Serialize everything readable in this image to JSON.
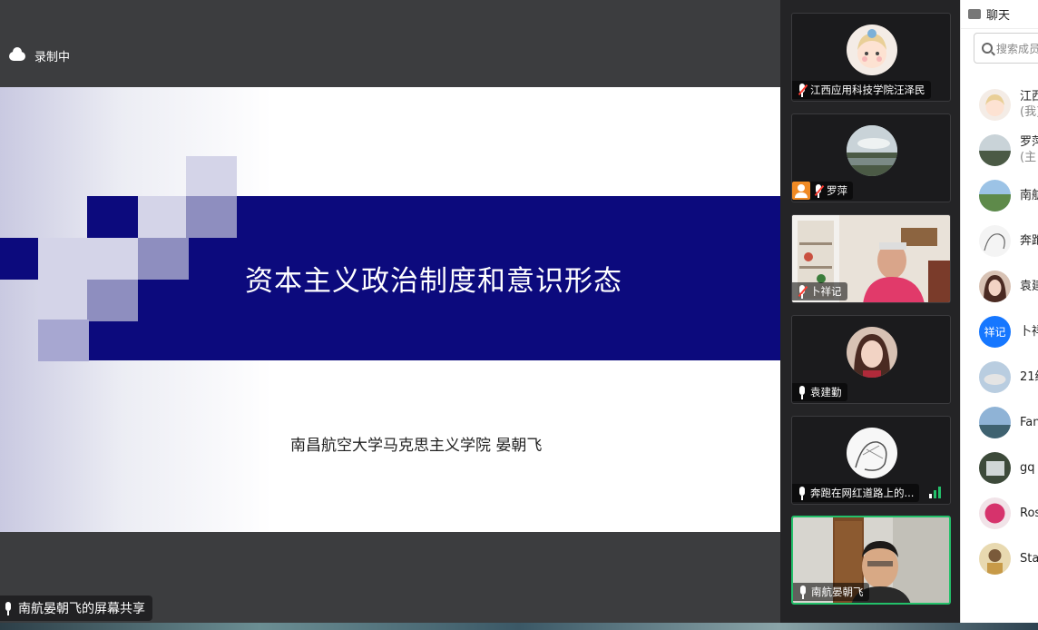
{
  "recording": {
    "label": "录制中",
    "icon": "cloud-icon"
  },
  "slide": {
    "title": "资本主义政治制度和意识形态",
    "author": "南昌航空大学马克思主义学院  晏朝飞"
  },
  "screen_share_label": "南航晏朝飞的屏幕共享",
  "gallery": [
    {
      "name": "江西应用科技学院汪泽民",
      "muted": true,
      "host": false,
      "avatar": "cartoon-avatar"
    },
    {
      "name": "罗萍",
      "muted": true,
      "host": true,
      "avatar": "landscape-avatar"
    },
    {
      "name": "卜祥记",
      "muted": true,
      "host": false,
      "video": true
    },
    {
      "name": "袁建勤",
      "muted": false,
      "host": false,
      "avatar": "woman-avatar"
    },
    {
      "name": "奔跑在网红道路上的...",
      "muted": false,
      "host": false,
      "avatar": "sketch-avatar",
      "speaking": true
    },
    {
      "name": "南航晏朝飞",
      "muted": false,
      "host": false,
      "video": true,
      "active": true
    }
  ],
  "chat": {
    "title": "聊天",
    "search_placeholder": "搜索成员",
    "participants": [
      {
        "name": "江西",
        "sub": "(我)"
      },
      {
        "name": "罗萍",
        "sub": "(主"
      },
      {
        "name": "南航"
      },
      {
        "name": "奔跑"
      },
      {
        "name": "袁建"
      },
      {
        "name": "卜祥",
        "avatar_text": "祥记"
      },
      {
        "name": "21级"
      },
      {
        "name": "Fan"
      },
      {
        "name": "gq"
      },
      {
        "name": "Ros"
      },
      {
        "name": "Sta"
      }
    ]
  },
  "colors": {
    "slide_band": "#0c0a7d",
    "active_border": "#23c06a",
    "host_badge": "#f08a24",
    "avatar_blue": "#1677ff"
  }
}
